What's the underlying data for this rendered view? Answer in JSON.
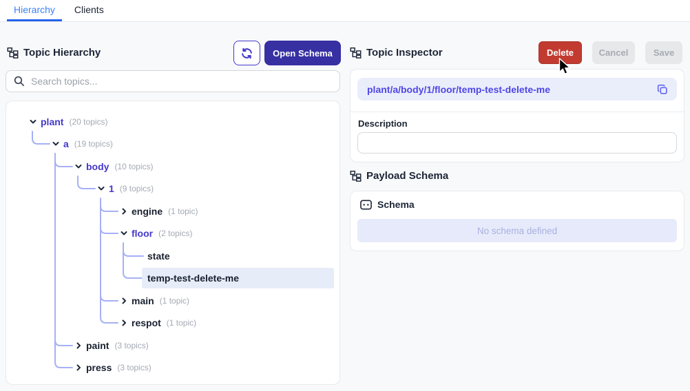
{
  "tabs": [
    {
      "label": "Hierarchy",
      "active": true
    },
    {
      "label": "Clients",
      "active": false
    }
  ],
  "left_panel": {
    "title": "Topic Hierarchy",
    "open_schema_label": "Open Schema",
    "search_placeholder": "Search topics...",
    "tree": [
      {
        "name": "plant",
        "count": "(20 topics)",
        "state": "expanded",
        "level": 0,
        "selected": false
      },
      {
        "name": "a",
        "count": "(19 topics)",
        "state": "expanded",
        "level": 1,
        "selected": false
      },
      {
        "name": "body",
        "count": "(10 topics)",
        "state": "expanded",
        "level": 2,
        "selected": false
      },
      {
        "name": "1",
        "count": "(9 topics)",
        "state": "expanded",
        "level": 3,
        "selected": false
      },
      {
        "name": "engine",
        "count": "(1 topic)",
        "state": "collapsed",
        "level": 4,
        "selected": false
      },
      {
        "name": "floor",
        "count": "(2 topics)",
        "state": "expanded",
        "level": 4,
        "selected": false
      },
      {
        "name": "state",
        "count": "",
        "state": "leaf",
        "level": 5,
        "selected": false
      },
      {
        "name": "temp-test-delete-me",
        "count": "",
        "state": "leaf",
        "level": 5,
        "selected": true
      },
      {
        "name": "main",
        "count": "(1 topic)",
        "state": "collapsed",
        "level": 4,
        "selected": false
      },
      {
        "name": "respot",
        "count": "(1 topic)",
        "state": "collapsed",
        "level": 4,
        "selected": false
      },
      {
        "name": "paint",
        "count": "(3 topics)",
        "state": "collapsed",
        "level": 2,
        "selected": false
      },
      {
        "name": "press",
        "count": "(3 topics)",
        "state": "collapsed",
        "level": 2,
        "selected": false
      }
    ]
  },
  "right_panel": {
    "title": "Topic Inspector",
    "delete_label": "Delete",
    "cancel_label": "Cancel",
    "save_label": "Save",
    "topic_path": "plant/a/body/1/floor/temp-test-delete-me",
    "description_label": "Description",
    "description_value": "",
    "payload_schema_title": "Payload Schema",
    "schema_label": "Schema",
    "no_schema_message": "No schema defined"
  },
  "colors": {
    "active_tab_blue": "#3b82f6",
    "tab_underline": "#2563eb",
    "open_schema_indigo": "#3730a3",
    "refresh_border_indigo": "#4338ca",
    "delete_red": "#c23b31",
    "disabled_button_bg": "#e7e8ea",
    "tree_node_indigo": "#4338ca",
    "connector_line": "#a5b0f5",
    "selected_row_bg": "#e6edf8",
    "path_bar_bg": "#eaeefb",
    "path_text_indigo": "#4f46e5",
    "no_schema_bg": "#e7eafa"
  }
}
